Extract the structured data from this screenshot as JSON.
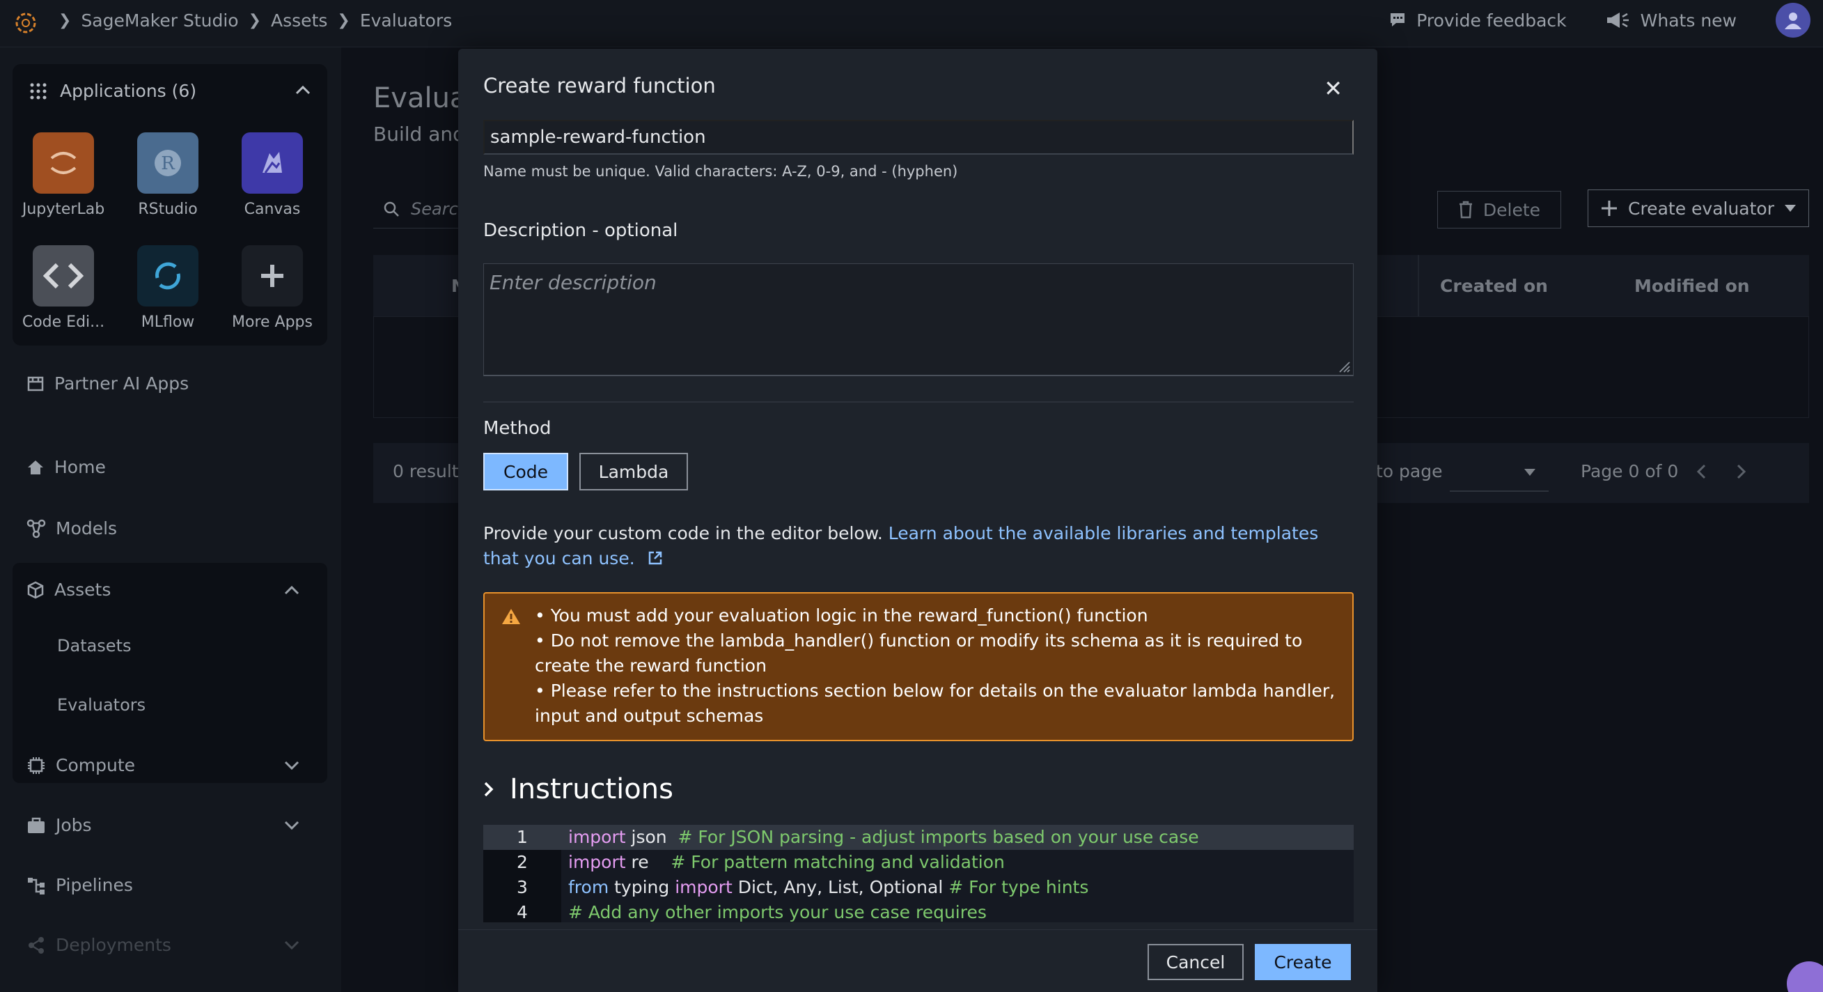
{
  "topbar": {
    "breadcrumbs": [
      "SageMaker Studio",
      "Assets",
      "Evaluators"
    ],
    "feedback_label": "Provide feedback",
    "whats_new_label": "Whats new"
  },
  "sidebar": {
    "applications_label": "Applications (6)",
    "apps": [
      {
        "label": "JupyterLab"
      },
      {
        "label": "RStudio"
      },
      {
        "label": "Canvas"
      },
      {
        "label": "Code Edi..."
      },
      {
        "label": "MLflow"
      },
      {
        "label": "More Apps"
      }
    ],
    "partner_label": "Partner AI Apps",
    "nav": {
      "home": "Home",
      "models": "Models",
      "assets": "Assets",
      "datasets": "Datasets",
      "evaluators": "Evaluators",
      "compute": "Compute",
      "jobs": "Jobs",
      "pipelines": "Pipelines",
      "deployments": "Deployments"
    }
  },
  "background": {
    "title_partial": "Evaluat",
    "subtitle_partial": "Build and",
    "search_placeholder_partial": "Searc",
    "delete_label": "Delete",
    "create_evaluator_label": "Create evaluator",
    "header_partial": "N",
    "col_created": "Created on",
    "col_modified": "Modified on",
    "results_partial": "0 result",
    "goto_partial": "to page",
    "page_label": "Page 0 of 0"
  },
  "modal": {
    "title": "Create reward function",
    "name_value": "sample-reward-function",
    "name_hint": "Name must be unique. Valid characters: A-Z, 0-9, and - (hyphen)",
    "description_label": "Description - optional",
    "description_placeholder": "Enter description",
    "method_label": "Method",
    "method_code": "Code",
    "method_lambda": "Lambda",
    "editor_text": "Provide your custom code in the editor below. ",
    "editor_link": "Learn about the available libraries and templates that you can use.",
    "alert_lines": [
      "• You must add your evaluation logic in the reward_function() function",
      "• Do not remove the lambda_handler() function or modify its schema as it is required to create the reward function",
      "• Please refer to the instructions section below for details on the evaluator lambda handler, input and output schemas"
    ],
    "instructions_label": "Instructions",
    "code_lines": [
      {
        "num": "1",
        "parts": [
          [
            "kw",
            "import"
          ],
          [
            "id",
            " json"
          ],
          [
            "cm",
            "  # For JSON parsing - adjust imports based on your use case"
          ]
        ]
      },
      {
        "num": "2",
        "parts": [
          [
            "kw",
            "import"
          ],
          [
            "id",
            " re"
          ],
          [
            "cm",
            "    # For pattern matching and validation"
          ]
        ]
      },
      {
        "num": "3",
        "parts": [
          [
            "kwb",
            "from"
          ],
          [
            "id",
            " typing "
          ],
          [
            "kw",
            "import"
          ],
          [
            "id",
            " Dict, Any, List, Optional"
          ],
          [
            "cm",
            " # For type hints"
          ]
        ]
      },
      {
        "num": "4",
        "parts": [
          [
            "cm",
            "# Add any other imports your use case requires"
          ]
        ]
      }
    ],
    "cancel_label": "Cancel",
    "create_label": "Create"
  },
  "colors": {
    "accent": "#7db8ff",
    "alert_bg": "#6b3a0f",
    "alert_border": "#e8922c",
    "modal_bg": "#1e232b"
  }
}
